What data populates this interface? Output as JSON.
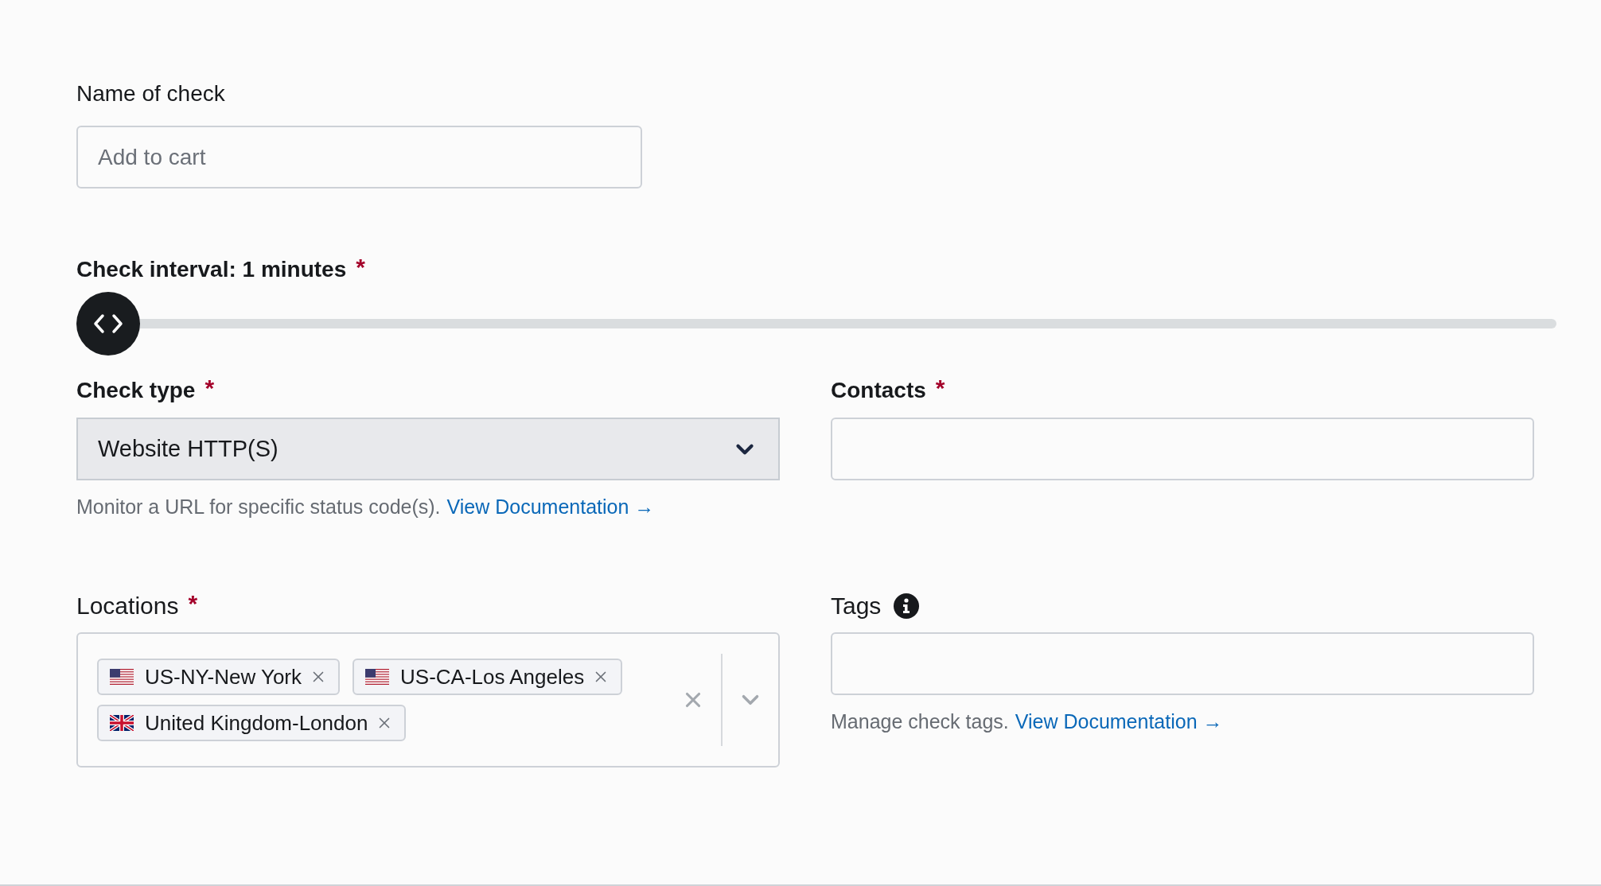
{
  "name_field": {
    "label": "Name of check",
    "placeholder": "Add to cart"
  },
  "interval": {
    "label": "Check interval: 1 minutes",
    "required_mark": "*",
    "level": 0
  },
  "check_type": {
    "label": "Check type",
    "required_mark": "*",
    "value": "Website HTTP(S)",
    "help": "Monitor a URL for specific status code(s).",
    "link": "View Documentation →"
  },
  "contacts": {
    "label": "Contacts",
    "required_mark": "*"
  },
  "locations": {
    "label": "Locations",
    "required_mark": "*",
    "chips": [
      {
        "label": "US-NY-New York",
        "kind": "us"
      },
      {
        "label": "US-CA-Los Angeles",
        "kind": "us"
      },
      {
        "label": "United Kingdom-London",
        "kind": "gb"
      }
    ]
  },
  "tags": {
    "label": "Tags",
    "help": "Manage check tags.",
    "link": "View Documentation →"
  }
}
